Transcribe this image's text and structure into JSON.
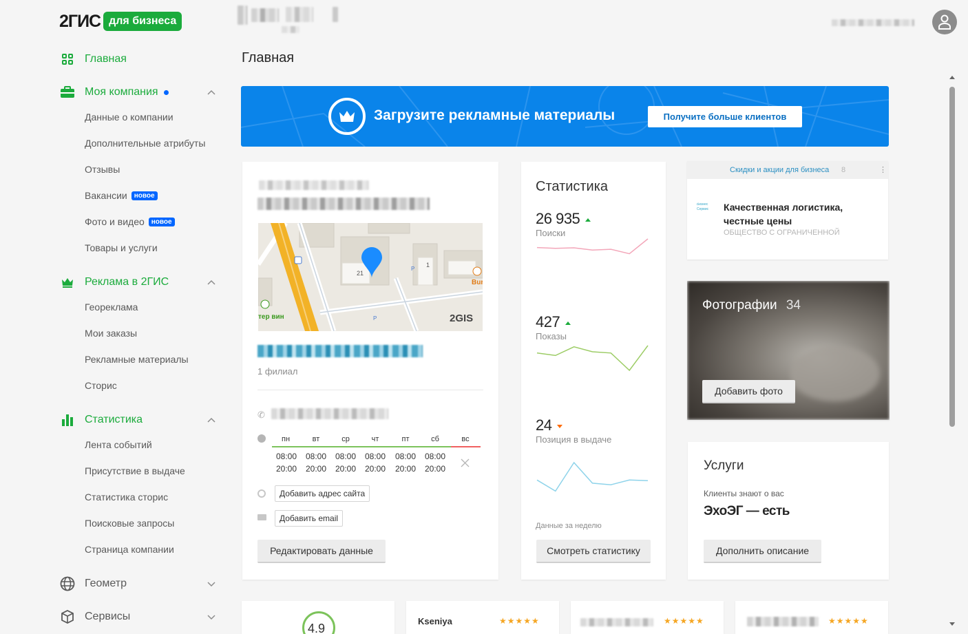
{
  "header": {
    "logo_text": "2ГИС",
    "logo_badge": "для бизнеса"
  },
  "sidebar": {
    "home": "Главная",
    "my_company": "Моя компания",
    "my_company_items": [
      "Данные о компании",
      "Дополнительные атрибуты",
      "Отзывы",
      "Вакансии",
      "Фото и видео",
      "Товары и услуги"
    ],
    "new_tag": "новое",
    "ads": "Реклама в 2ГИС",
    "ads_items": [
      "Геореклама",
      "Мои заказы",
      "Рекламные материалы",
      "Сторис"
    ],
    "stats": "Статистика",
    "stats_items": [
      "Лента событий",
      "Присутствие в выдаче",
      "Статистика сторис",
      "Поисковые запросы",
      "Страница компании"
    ],
    "geometer": "Геометр",
    "services": "Сервисы"
  },
  "main": {
    "title": "Главная",
    "banner_title": "Загрузите рекламные материалы",
    "banner_button": "Получите больше клиентов"
  },
  "company_card": {
    "branches": "1 филиал",
    "map_brand": "2GIS",
    "map_building_number": "21",
    "map_building_number_2": "1",
    "map_shop_label": "тер вин",
    "map_bur_label": "Bur",
    "map_parking": "P",
    "schedule_days": [
      "пн",
      "вт",
      "ср",
      "чт",
      "пт",
      "сб",
      "вс"
    ],
    "schedule_open": [
      "08:00",
      "08:00",
      "08:00",
      "08:00",
      "08:00",
      "08:00"
    ],
    "schedule_close": [
      "20:00",
      "20:00",
      "20:00",
      "20:00",
      "20:00",
      "20:00"
    ],
    "add_site": "Добавить адрес сайта",
    "add_email": "Добавить email",
    "edit_button": "Редактировать данные"
  },
  "stats_card": {
    "title": "Статистика",
    "searches_value": "26 935",
    "searches_label": "Поиски",
    "shows_value": "427",
    "shows_label": "Показы",
    "position_value": "24",
    "position_label": "Позиция в выдаче",
    "period": "Данные за неделю",
    "button": "Смотреть статистику",
    "colors": {
      "searches": "#f3a6b9",
      "shows": "#9ccc65",
      "position": "#8ed3ea"
    },
    "series": {
      "searches": [
        0.35,
        0.38,
        0.36,
        0.45,
        0.42,
        0.6,
        0.0
      ],
      "shows": [
        0.3,
        0.4,
        0.05,
        0.25,
        0.3,
        1.0,
        0.0
      ],
      "position": [
        0.55,
        0.9,
        0.0,
        0.65,
        0.7,
        0.55,
        0.57
      ]
    }
  },
  "promo_card": {
    "header": "Скидки и акции для бизнеса",
    "count": "8",
    "headline": "Качественная логистика, честные цены",
    "subline": "ОБЩЕСТВО С ОГРАНИЧЕННОЙ",
    "logo_text": "Бизнес Сервис"
  },
  "photos_card": {
    "title": "Фотографии",
    "count": "34",
    "button": "Добавить фото"
  },
  "services_card": {
    "title": "Услуги",
    "subtitle": "Клиенты знают о вас",
    "headline": "ЭхоЭГ — есть",
    "button": "Дополнить описание"
  },
  "reviews": {
    "rating": "4.9",
    "reviewer_1": "Kseniya",
    "stars": "★★★★★"
  }
}
